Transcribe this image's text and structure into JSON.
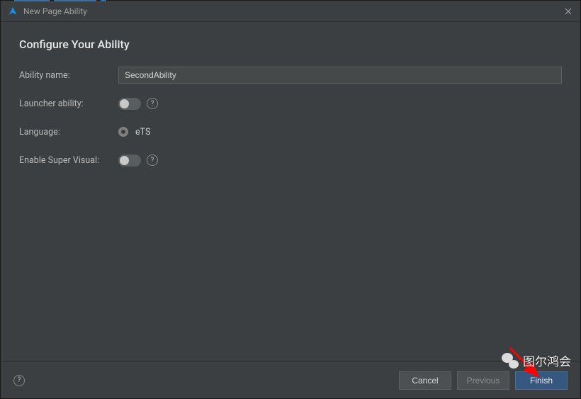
{
  "titlebar": {
    "title": "New Page Ability"
  },
  "page": {
    "heading": "Configure Your Ability"
  },
  "form": {
    "ability_name": {
      "label": "Ability name:",
      "value": "SecondAbility"
    },
    "launcher_ability": {
      "label": "Launcher ability:",
      "enabled": false
    },
    "language": {
      "label": "Language:",
      "option": "eTS"
    },
    "enable_super_visual": {
      "label": "Enable Super Visual:",
      "enabled": false
    }
  },
  "footer": {
    "cancel": "Cancel",
    "previous": "Previous",
    "finish": "Finish"
  },
  "overlay": {
    "wechat_label": "图尔鸿会"
  }
}
